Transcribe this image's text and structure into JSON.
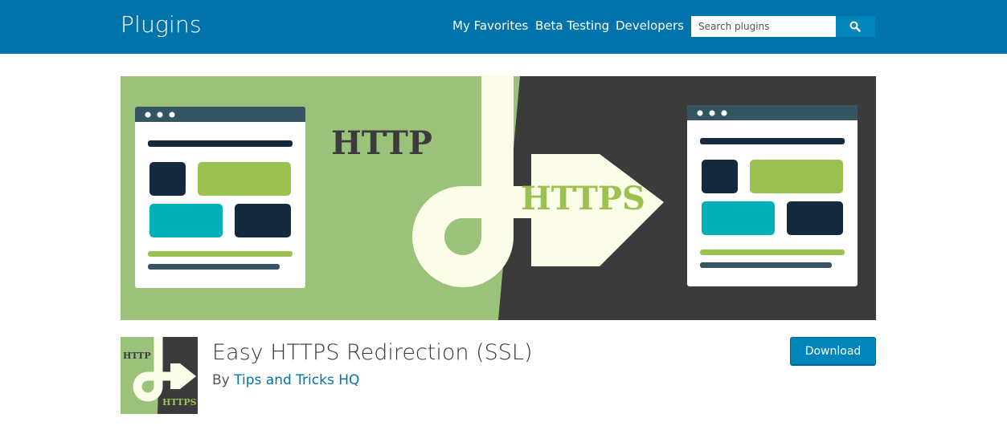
{
  "header": {
    "site_title": "Plugins",
    "nav": [
      "My Favorites",
      "Beta Testing",
      "Developers"
    ],
    "search": {
      "placeholder": "Search plugins",
      "button_icon": "search-icon"
    }
  },
  "banner": {
    "left_label": "HTTP",
    "right_label": "HTTPS",
    "colors": {
      "green": "#9bc27b",
      "dark": "#3b3b3b",
      "cream": "#fcfde9",
      "navy": "#15293e",
      "teal": "#02b0b9",
      "lime": "#9bc151",
      "slate": "#365562"
    }
  },
  "plugin": {
    "title": "Easy HTTPS Redirection (SSL)",
    "by_label": "By",
    "author": "Tips and Tricks HQ",
    "download_label": "Download",
    "icon_labels": {
      "top": "HTTP",
      "bottom": "HTTPS"
    }
  }
}
